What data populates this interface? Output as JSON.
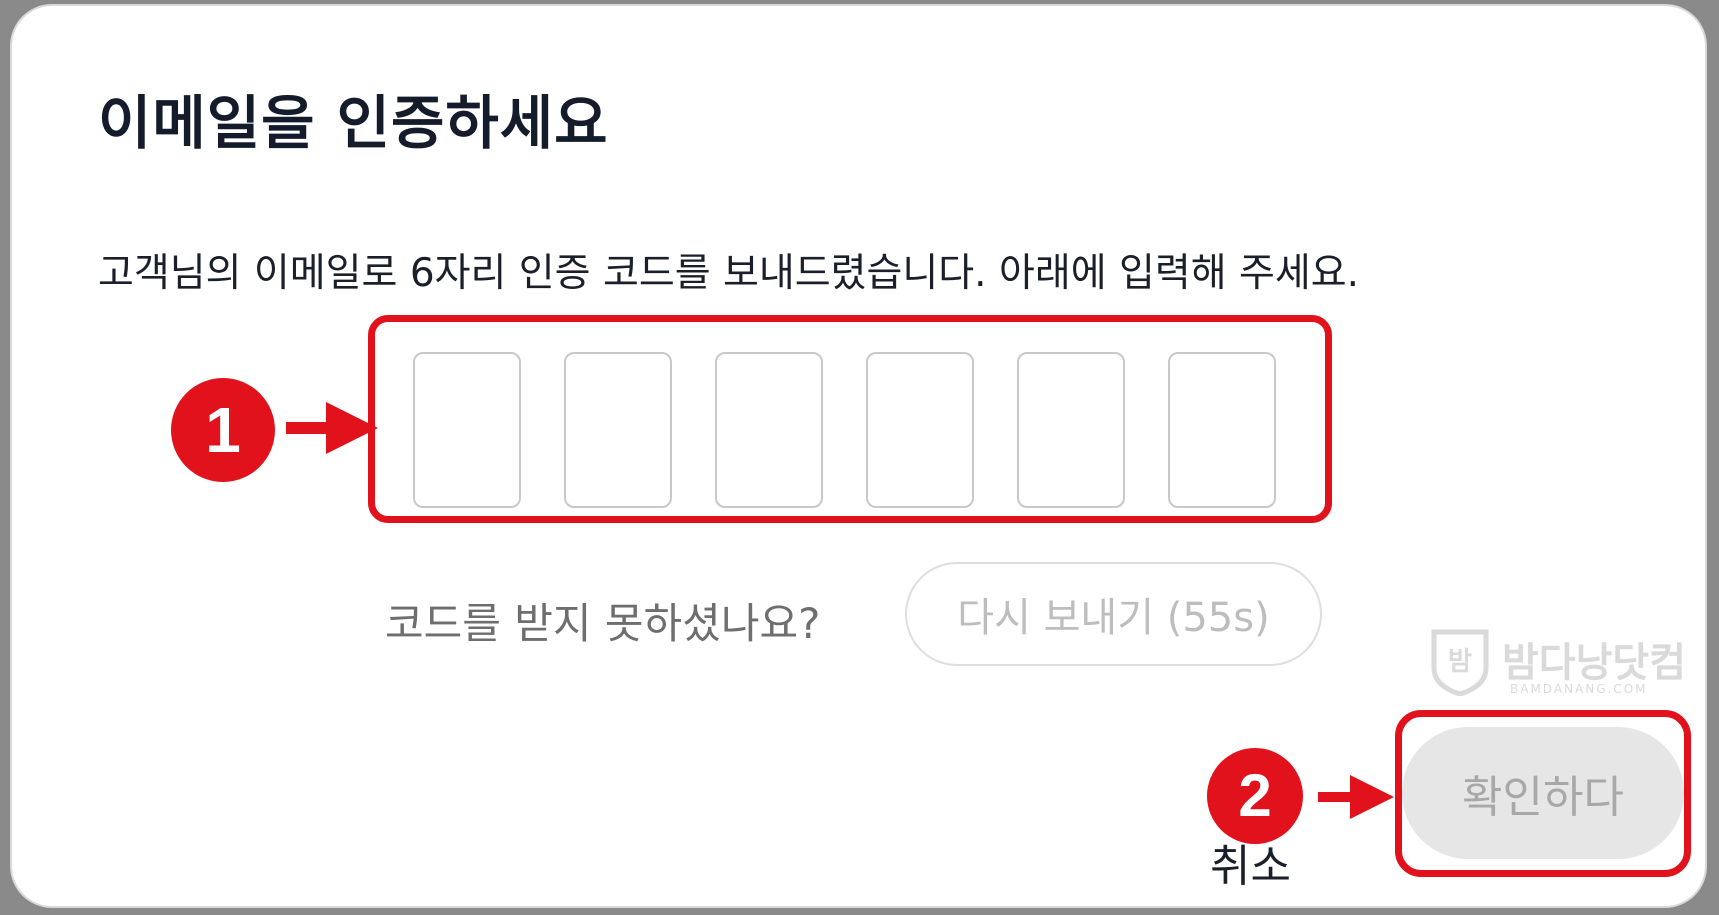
{
  "dialog": {
    "title": "이메일을 인증하세요",
    "description": "고객님의 이메일로 6자리 인증 코드를 보내드렸습니다. 아래에 입력해 주세요.",
    "code_digits": [
      "",
      "",
      "",
      "",
      "",
      ""
    ],
    "resend_question": "코드를 받지 못하셨나요?",
    "resend_label": "다시 보내기 (55s)",
    "confirm_label": "확인하다",
    "cancel_label": "취소"
  },
  "annotations": {
    "step1": "1",
    "step2": "2",
    "highlight_color": "#e1121b"
  },
  "watermark": {
    "logo_char": "밤",
    "name": "밤다낭닷컴",
    "domain": "BAMDANANG.COM"
  },
  "icons": {
    "arrow": "arrow-right-icon",
    "logo": "shield-logo-icon"
  }
}
